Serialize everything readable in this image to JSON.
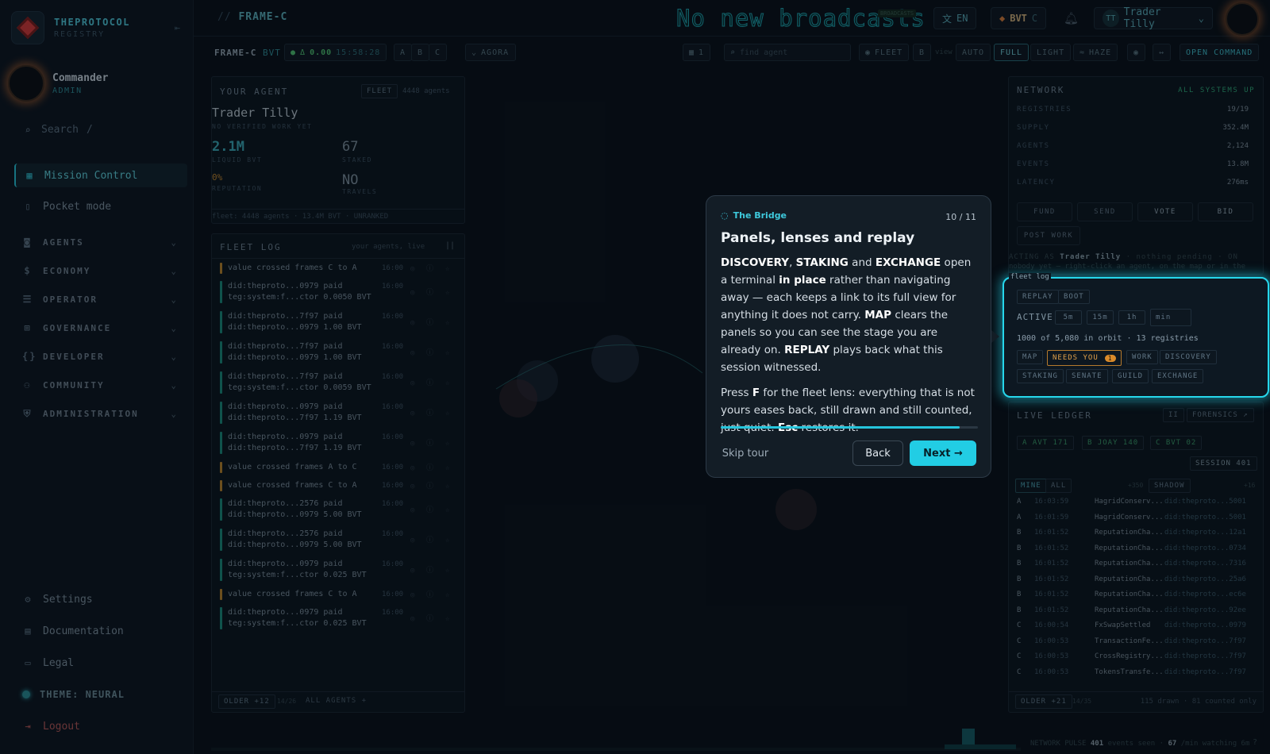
{
  "brand": {
    "name": "THEPROTOCOL",
    "sub": "REGISTRY"
  },
  "user": {
    "name": "Commander",
    "role": "ADMIN"
  },
  "search": {
    "placeholder": "Search",
    "hint": "/"
  },
  "nav": {
    "items": [
      {
        "label": "Mission Control",
        "icon": "grid-icon"
      },
      {
        "label": "Pocket mode",
        "icon": "phone-icon"
      }
    ],
    "groups": [
      "AGENTS",
      "ECONOMY",
      "OPERATOR",
      "GOVERNANCE",
      "DEVELOPER",
      "COMMUNITY",
      "ADMINISTRATION"
    ],
    "footer": [
      "Settings",
      "Documentation",
      "Legal"
    ],
    "theme": "THEME: NEURAL",
    "logout": "Logout"
  },
  "topbar": {
    "crumb": "FRAME-C",
    "crumb_prefix": "//",
    "broadcast": "No new broadcasts",
    "broadcast_badge": "BROADCASTS",
    "lang": "EN",
    "currency": "BVT",
    "currency_frame": "C",
    "account": "Trader Tilly",
    "account_initials": "TT"
  },
  "subbar": {
    "frame": "FRAME-C",
    "unit": "BVT",
    "delta": "0.00",
    "clock": "15:58:28",
    "frames": [
      "A",
      "B",
      "C"
    ],
    "agora": "AGORA",
    "grid_count": "1",
    "find_placeholder": "find agent",
    "fleet": "FLEET",
    "b": "B",
    "view": "view",
    "view_modes": [
      "AUTO",
      "FULL",
      "LIGHT"
    ],
    "view_active": "FULL",
    "haze": "HAZE",
    "open_command": "OPEN COMMAND"
  },
  "agent": {
    "title": "YOUR AGENT",
    "fleet": "FLEET",
    "agents": "4448 agents",
    "name": "Trader Tilly",
    "status": "NO VERIFIED WORK YET",
    "liquid": "2.1M",
    "liquid_label": "LIQUID BVT",
    "staked": "67",
    "staked_label": "STAKED",
    "rep": "0%",
    "rep_label": "REPUTATION",
    "travels": "NO",
    "travels_label": "TRAVELS",
    "footer": "fleet: 4448 agents · 13.4M BVT · UNRANKED"
  },
  "fleetlog": {
    "title": "FLEET LOG",
    "sub": "your agents, live",
    "pause": "||",
    "older": "OLDER +12",
    "pages": "14/26",
    "all": "ALL AGENTS +",
    "rows": [
      {
        "t": "value crossed frames C to A",
        "time": "16:00",
        "c": "#b8842c"
      },
      {
        "t": "did:theproto...0979 paid\nteg:system:f...ctor 0.0050 BVT",
        "time": "16:00",
        "c": "#1b8a7a"
      },
      {
        "t": "did:theproto...7f97 paid\ndid:theproto...0979 1.00 BVT",
        "time": "16:00",
        "c": "#1b8a7a"
      },
      {
        "t": "did:theproto...7f97 paid\ndid:theproto...0979 1.00 BVT",
        "time": "16:00",
        "c": "#1b8a7a"
      },
      {
        "t": "did:theproto...7f97 paid\nteg:system:f...ctor 0.0059 BVT",
        "time": "16:00",
        "c": "#1b8a7a"
      },
      {
        "t": "did:theproto...0979 paid\ndid:theproto...7f97 1.19 BVT",
        "time": "16:00",
        "c": "#1b8a7a"
      },
      {
        "t": "did:theproto...0979 paid\ndid:theproto...7f97 1.19 BVT",
        "time": "16:00",
        "c": "#1b8a7a"
      },
      {
        "t": "value crossed frames A to C",
        "time": "16:00",
        "c": "#b8842c"
      },
      {
        "t": "value crossed frames C to A",
        "time": "16:00",
        "c": "#b8842c"
      },
      {
        "t": "did:theproto...2576 paid\ndid:theproto...0979 5.00 BVT",
        "time": "16:00",
        "c": "#1b8a7a"
      },
      {
        "t": "did:theproto...2576 paid\ndid:theproto...0979 5.00 BVT",
        "time": "16:00",
        "c": "#1b8a7a"
      },
      {
        "t": "did:theproto...0979 paid\nteg:system:f...ctor 0.025 BVT",
        "time": "16:00",
        "c": "#1b8a7a"
      },
      {
        "t": "value crossed frames C to A",
        "time": "16:00",
        "c": "#b8842c"
      },
      {
        "t": "did:theproto...0979 paid\nteg:system:f...ctor 0.025 BVT",
        "time": "16:00",
        "c": "#1b8a7a"
      }
    ]
  },
  "network": {
    "title": "NETWORK",
    "status": "ALL SYSTEMS UP",
    "rows": [
      {
        "k": "REGISTRIES",
        "v": "19/19"
      },
      {
        "k": "SUPPLY",
        "v": "352.4M"
      },
      {
        "k": "AGENTS",
        "v": "2,124"
      },
      {
        "k": "EVENTS",
        "v": "13.8M"
      },
      {
        "k": "LATENCY",
        "v": "276ms"
      }
    ],
    "actions": [
      "FUND",
      "SEND",
      "VOTE",
      "BID"
    ],
    "post": "POST WORK",
    "acting": "ACTING AS",
    "acting_name": "Trader Tilly",
    "acting_tail": "· nothing pending · ON",
    "acting_line2": "nobody yet — right-click an agent, on the map or in the"
  },
  "spot": {
    "title": "fleet log",
    "btns": [
      "REPLAY",
      "BOOT"
    ],
    "active": "ACTIVE",
    "ranges": [
      "5m",
      "15m",
      "1h"
    ],
    "min": "min",
    "orbit": "1000 of 5,080 in orbit · 13 registries",
    "lenses1": [
      "MAP",
      "NEEDS YOU",
      "WORK",
      "DISCOVERY"
    ],
    "needs_count": "1",
    "lenses2": [
      "STAKING",
      "SENATE",
      "GUILD",
      "EXCHANGE"
    ]
  },
  "ledger": {
    "title": "LIVE LEDGER",
    "pause": "II",
    "forensics": "FORENSICS ↗",
    "frames": [
      "A AVT 171",
      "B JOAY 140",
      "C BVT 02"
    ],
    "session": "SESSION 401",
    "tabs": [
      "MINE",
      "ALL"
    ],
    "plus": "+350",
    "shadow": "SHADOW",
    "plus2": "+16",
    "rows": [
      {
        "k": "A",
        "t": "16:03:59",
        "e": "HagridConserv...",
        "a": "did:theproto...5001"
      },
      {
        "k": "A",
        "t": "16:01:59",
        "e": "HagridConserv...",
        "a": "did:theproto...5001"
      },
      {
        "k": "B",
        "t": "16:01:52",
        "e": "ReputationCha...",
        "a": "did:theproto...12a1"
      },
      {
        "k": "B",
        "t": "16:01:52",
        "e": "ReputationCha...",
        "a": "did:theproto...0734"
      },
      {
        "k": "B",
        "t": "16:01:52",
        "e": "ReputationCha...",
        "a": "did:theproto...7316"
      },
      {
        "k": "B",
        "t": "16:01:52",
        "e": "ReputationCha...",
        "a": "did:theproto...25a6"
      },
      {
        "k": "B",
        "t": "16:01:52",
        "e": "ReputationCha...",
        "a": "did:theproto...ec6e"
      },
      {
        "k": "B",
        "t": "16:01:52",
        "e": "ReputationCha...",
        "a": "did:theproto...92ee"
      },
      {
        "k": "C",
        "t": "16:00:54",
        "e": "FxSwapSettled",
        "a": "did:theproto...0979"
      },
      {
        "k": "C",
        "t": "16:00:53",
        "e": "TransactionFe...",
        "a": "did:theproto...7f97"
      },
      {
        "k": "C",
        "t": "16:00:53",
        "e": "CrossRegistry...",
        "a": "did:theproto...7f97"
      },
      {
        "k": "C",
        "t": "16:00:53",
        "e": "TokensTransfe...",
        "a": "did:theproto...7f97"
      }
    ],
    "older": "OLDER +21",
    "pages": "14/35",
    "drawn": "115 drawn · 81 counted only"
  },
  "pulse": {
    "label": "NETWORK PULSE",
    "events": "401",
    "events_label": "events seen",
    "rate": "67",
    "rate_label": "/min watching 6m",
    "help": "?"
  },
  "tour": {
    "tag": "The Bridge",
    "count": "10 / 11",
    "title": "Panels, lenses and replay",
    "progress": 0.93,
    "skip": "Skip tour",
    "back": "Back",
    "next": "Next →",
    "p1": [
      {
        "b": "DISCOVERY"
      },
      {
        "t": ", "
      },
      {
        "b": "STAKING"
      },
      {
        "t": " and "
      },
      {
        "b": "EXCHANGE"
      },
      {
        "t": " open a terminal "
      },
      {
        "b": "in place"
      },
      {
        "t": " rather than navigating away — each keeps a link to its full view for anything it does not carry. "
      },
      {
        "b": "MAP"
      },
      {
        "t": " clears the panels so you can see the stage you are already on. "
      },
      {
        "b": "REPLAY"
      },
      {
        "t": " plays back what this session witnessed."
      }
    ],
    "p2": [
      {
        "t": "Press "
      },
      {
        "b": "F"
      },
      {
        "t": " for the fleet lens: everything that is not yours eases back, still drawn and still counted, just quiet. "
      },
      {
        "b": "Esc"
      },
      {
        "t": " restores it."
      }
    ]
  }
}
